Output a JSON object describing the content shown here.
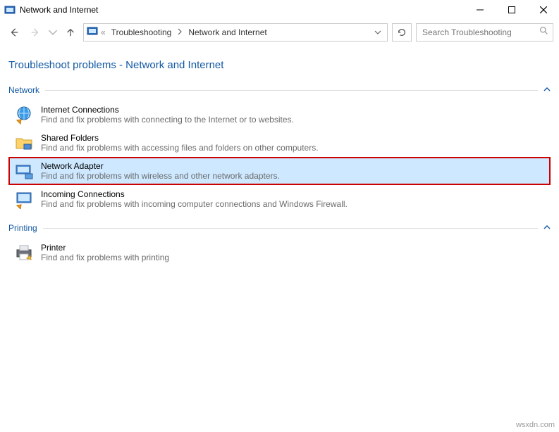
{
  "window": {
    "title": "Network and Internet"
  },
  "breadcrumb": {
    "prefix": "«",
    "items": [
      {
        "label": "Troubleshooting"
      },
      {
        "label": "Network and Internet"
      }
    ]
  },
  "search": {
    "placeholder": "Search Troubleshooting"
  },
  "page": {
    "title": "Troubleshoot problems - Network and Internet"
  },
  "sections": [
    {
      "label": "Network",
      "items": [
        {
          "title": "Internet Connections",
          "desc": "Find and fix problems with connecting to the Internet or to websites.",
          "icon": "globe-arrow",
          "selected": false
        },
        {
          "title": "Shared Folders",
          "desc": "Find and fix problems with accessing files and folders on other computers.",
          "icon": "folder-net",
          "selected": false
        },
        {
          "title": "Network Adapter",
          "desc": "Find and fix problems with wireless and other network adapters.",
          "icon": "adapter",
          "selected": true
        },
        {
          "title": "Incoming Connections",
          "desc": "Find and fix problems with incoming computer connections and Windows Firewall.",
          "icon": "screen-arrow",
          "selected": false
        }
      ]
    },
    {
      "label": "Printing",
      "items": [
        {
          "title": "Printer",
          "desc": "Find and fix problems with printing",
          "icon": "printer",
          "selected": false
        }
      ]
    }
  ],
  "watermark": "wsxdn.com"
}
